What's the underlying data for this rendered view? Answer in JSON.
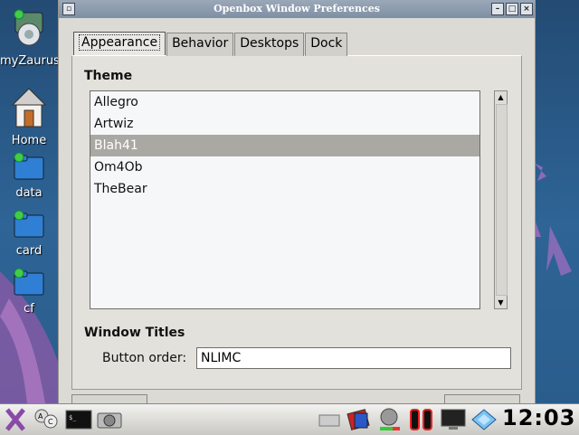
{
  "window": {
    "title": "Openbox Window Preferences",
    "buttons": {
      "restore": "▫",
      "minimize": "–",
      "maximize": "□",
      "close": "×"
    }
  },
  "desktop": {
    "icons": [
      {
        "label": "myZaurus",
        "icon": "computer-icon"
      },
      {
        "label": "Home",
        "icon": "home-icon"
      },
      {
        "label": "data",
        "icon": "folder-icon"
      },
      {
        "label": "card",
        "icon": "folder-icon"
      },
      {
        "label": "cf",
        "icon": "folder-icon"
      }
    ]
  },
  "tabs": [
    {
      "label": "Appearance",
      "active": true
    },
    {
      "label": "Behavior"
    },
    {
      "label": "Desktops"
    },
    {
      "label": "Dock"
    }
  ],
  "theme": {
    "title": "Theme",
    "items": [
      "Allegro",
      "Artwiz",
      "Blah41",
      "Om4Ob",
      "TheBear"
    ],
    "selected": "Blah41"
  },
  "window_titles": {
    "title": "Window Titles",
    "button_order_label": "Button order:",
    "button_order_value": "NLIMC"
  },
  "taskbar": {
    "clock": "12:03",
    "icons": [
      "launcher-x-icon",
      "input-method-icon",
      "terminal-icon",
      "camera-icon",
      "keyboard-icon",
      "card-icon",
      "volume-icon",
      "battery-icon",
      "monitor-icon",
      "network-icon"
    ]
  },
  "colors": {
    "desktop": "#2e5b86",
    "selection": "#aaa8a3",
    "window_bg": "#dcdad5"
  }
}
